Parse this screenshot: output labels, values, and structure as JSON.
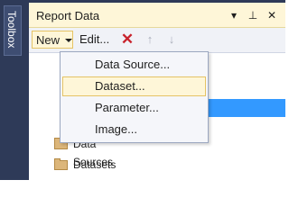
{
  "toolbox": {
    "label": "Toolbox"
  },
  "panel": {
    "title": "Report Data",
    "title_buttons": {
      "dropdown": "▾",
      "pin": "⊥",
      "close": "✕"
    }
  },
  "toolbar": {
    "new_label": "New",
    "edit_label": "Edit...",
    "delete_glyph": "✕",
    "up_glyph": "↑",
    "down_glyph": "↓"
  },
  "menu": {
    "items": [
      {
        "label": "Data Source..."
      },
      {
        "label": "Dataset...",
        "highlighted": true
      },
      {
        "label": "Parameter..."
      },
      {
        "label": "Image..."
      }
    ]
  },
  "tree": {
    "items": [
      {
        "label": "Data Sources"
      },
      {
        "label": "Datasets"
      }
    ]
  },
  "colors": {
    "accent_hover": "#fef6d8",
    "selection_blue": "#3399ff",
    "frame_dark": "#2e3a58",
    "delete_red": "#c8232c"
  }
}
